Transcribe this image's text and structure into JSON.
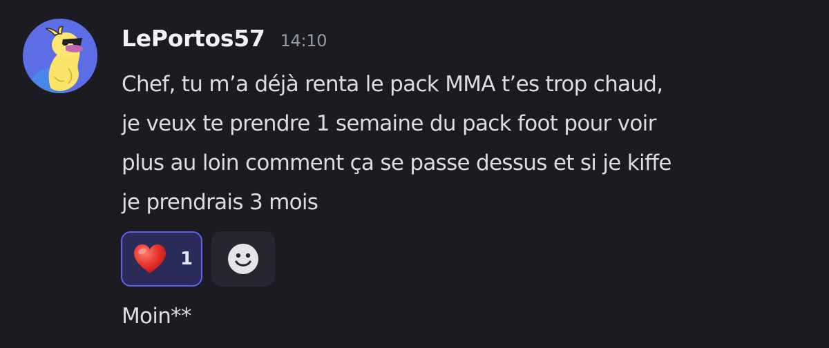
{
  "message": {
    "author": "LePortos57",
    "timestamp": "14:10",
    "avatar_icon": "duck-avatar-icon",
    "lines": [
      "Chef, tu m’a déjà renta le pack MMA t’es trop chaud,",
      "je veux te prendre 1 semaine du pack foot pour voir",
      "plus au loin comment ça se passe dessus et si je kiffe",
      "je prendrais 3 mois"
    ]
  },
  "reactions": [
    {
      "emoji": "red-heart-icon",
      "count": "1",
      "reacted": true
    }
  ],
  "add_reaction_icon": "smiley-icon",
  "followup": {
    "text": "Moin**"
  },
  "colors": {
    "background": "#1b1b21",
    "username": "#f2f3f5",
    "timestamp": "#949ba4",
    "body_text": "#dbdee1",
    "reaction_border": "#5865f2",
    "reaction_bg": "#2a2b58",
    "avatar_bg": "#5b6ee6"
  }
}
